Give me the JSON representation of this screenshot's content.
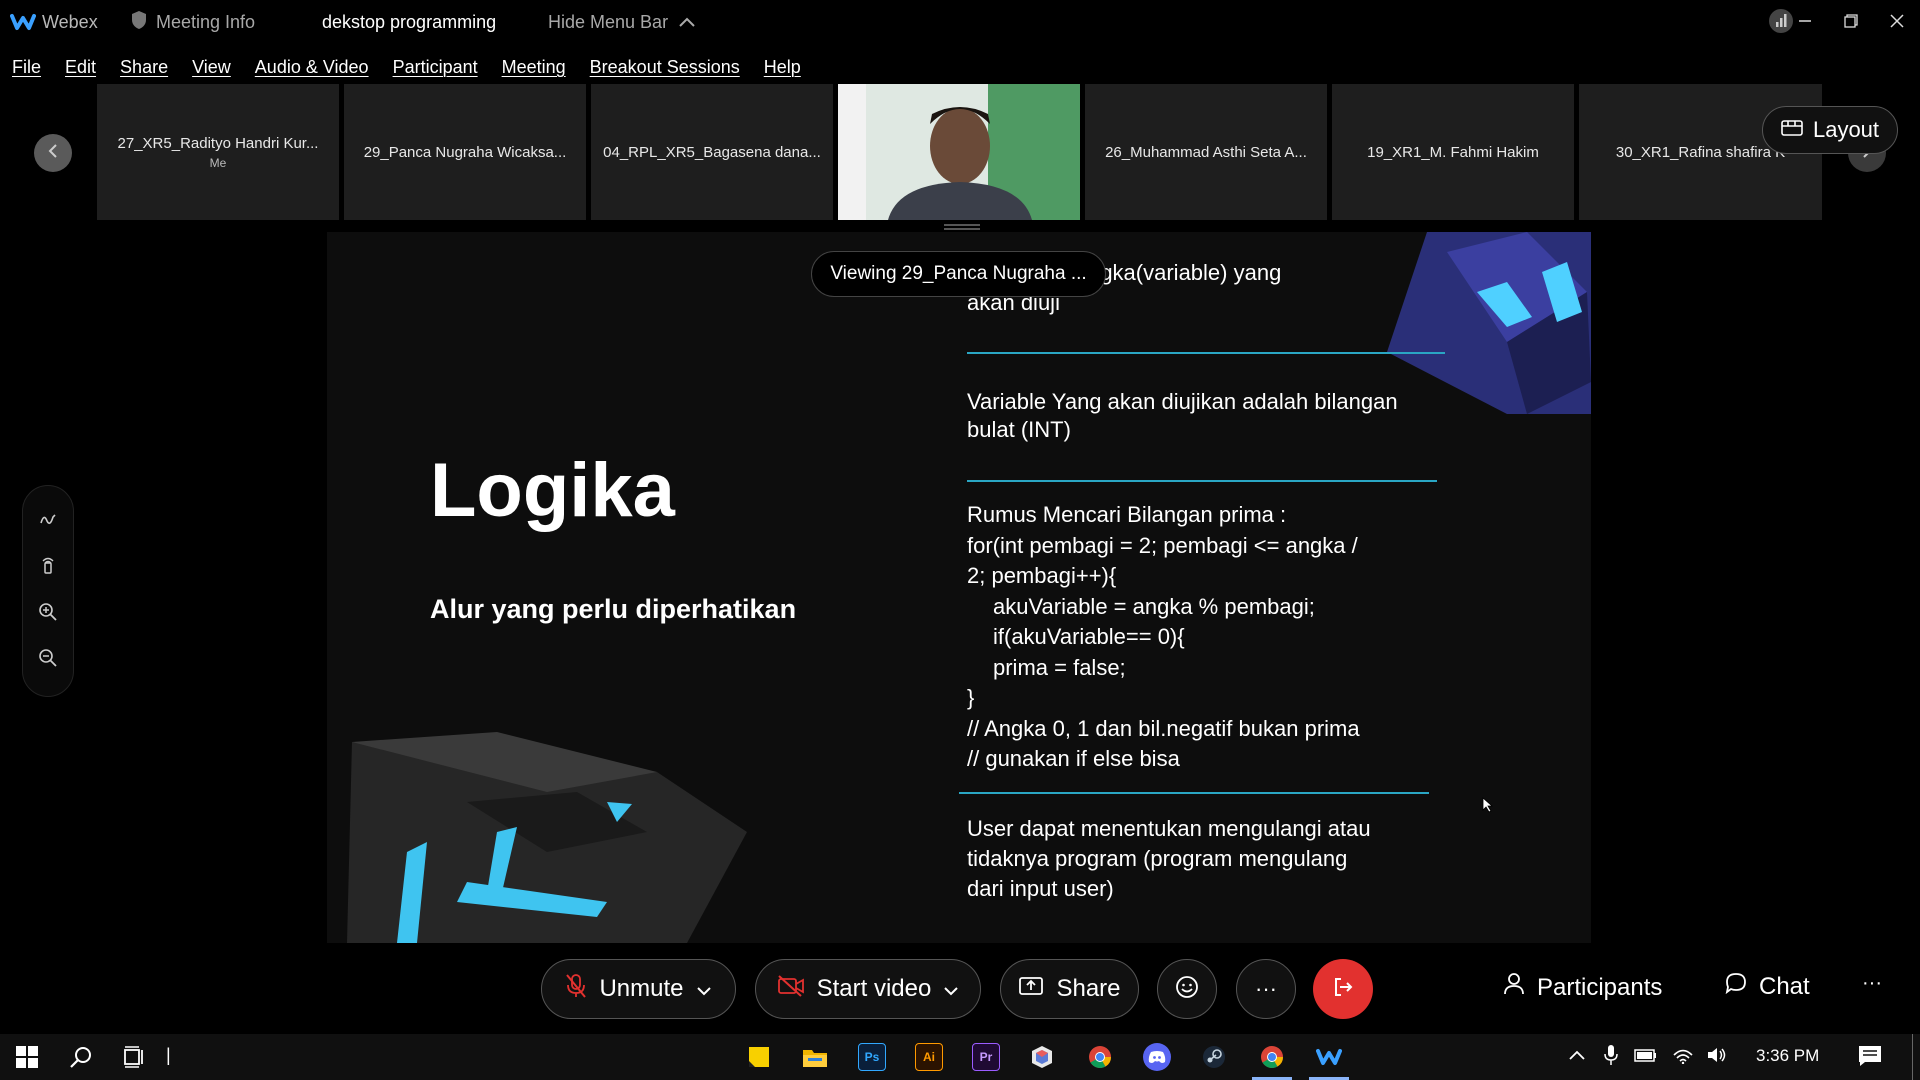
{
  "titlebar": {
    "app_name": "Webex",
    "meeting_info": "Meeting Info",
    "meeting_title": "dekstop programming",
    "hide_menu": "Hide Menu Bar"
  },
  "menu": [
    "File",
    "Edit",
    "Share",
    "View",
    "Audio & Video",
    "Participant",
    "Meeting",
    "Breakout Sessions",
    "Help"
  ],
  "filmstrip": {
    "tiles": [
      {
        "name": "27_XR5_Radityo Handri Kur...",
        "sub": "Me"
      },
      {
        "name": "29_Panca Nugraha Wicaksa...",
        "sub": ""
      },
      {
        "name": "04_RPL_XR5_Bagasena dana...",
        "sub": ""
      },
      {
        "name": "",
        "sub": "",
        "video": true
      },
      {
        "name": "26_Muhammad Asthi Seta A...",
        "sub": ""
      },
      {
        "name": "19_XR1_M. Fahmi Hakim",
        "sub": ""
      },
      {
        "name": "30_XR1_Rafina shafira K",
        "sub": ""
      }
    ],
    "layout_label": "Layout"
  },
  "viewing_label": "Viewing 29_Panca Nugraha ...",
  "slide": {
    "title": "Logika",
    "subtitle": "Alur yang perlu diperhatikan",
    "block1_line1": "Menginput angka(variable) yang",
    "block1_line2": "akan diuji",
    "block2_line1": "Variable Yang akan diujikan adalah bilangan",
    "block2_line2": "bulat (INT)",
    "block3_lines": [
      "Rumus Mencari Bilangan prima :",
      "for(int pembagi = 2; pembagi <= angka /",
      "2; pembagi++){",
      "   akuVariable = angka % pembagi;",
      "   if(akuVariable== 0){",
      "   prima = false;",
      "}",
      "// Angka 0, 1 dan bil.negatif bukan prima",
      "// gunakan if else bisa"
    ],
    "block4_line1": "User dapat menentukan mengulangi atau",
    "block4_line2": "tidaknya program (program mengulang",
    "block4_line3": "dari input user)"
  },
  "controls": {
    "unmute": "Unmute",
    "start_video": "Start video",
    "share": "Share",
    "more": "···",
    "participants": "Participants",
    "chat": "Chat",
    "overflow": "···"
  },
  "taskbar": {
    "search_cursor": "|",
    "clock": "3:36 PM",
    "apps": [
      "sticky-notes",
      "file-explorer",
      "photoshop",
      "illustrator",
      "premiere",
      "shield-app",
      "chrome",
      "discord",
      "steam",
      "chrome",
      "webex"
    ],
    "app_labels": {
      "photoshop": "Ps",
      "illustrator": "Ai",
      "premiere": "Pr"
    }
  },
  "colors": {
    "accent_line": "#2aa6c4",
    "leave_red": "#e2312f",
    "slide_bg": "#0d0d0d"
  }
}
